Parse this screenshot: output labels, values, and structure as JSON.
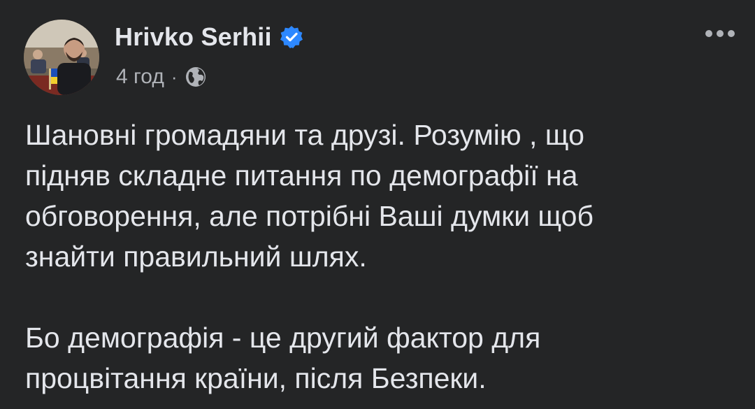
{
  "post": {
    "author": {
      "name": "Hrivko Serhii",
      "verified": true,
      "verified_color": "#2d88ff"
    },
    "time": "4 год",
    "separator": "·",
    "audience_icon": "globe-icon",
    "more_icon": "more-horizontal-icon",
    "paragraphs": [
      "Шановні громадяни та друзі. Розумію , що\nпідняв складне питання по демографії на\nобговорення, але потрібні Ваші думки щоб\nзнайти правильний шлях.",
      "Бо демографія - це другий фактор для\nпроцвітання країни, після Безпеки."
    ]
  },
  "theme": {
    "background": "#242526",
    "text": "#e4e6eb",
    "secondary_text": "#b0b3b8"
  }
}
